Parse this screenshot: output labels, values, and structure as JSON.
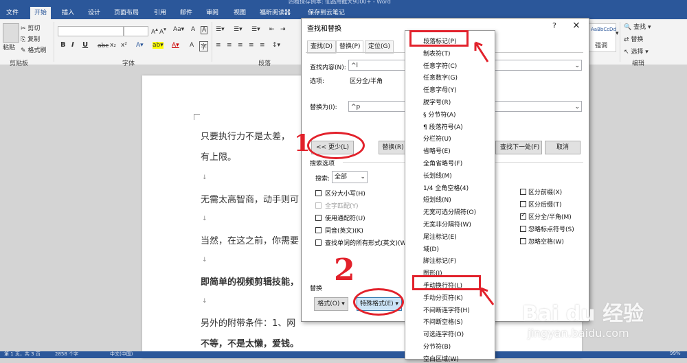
{
  "window": {
    "title": "四概保存例本: 仙品用截大9000+ - Word"
  },
  "tabs": [
    "文件",
    "开始",
    "插入",
    "设计",
    "页面布局",
    "引用",
    "邮件",
    "审阅",
    "视图",
    "福昕阅读器",
    "保存到云笔记"
  ],
  "active_tab": "开始",
  "ribbon": {
    "clipboard": {
      "paste": "粘贴",
      "cut": "剪切",
      "copy": "复制",
      "format_painter": "格式刷",
      "group": "剪贴板"
    },
    "font": {
      "group": "字体",
      "format_buttons": [
        "B",
        "I",
        "U",
        "abc",
        "x₂",
        "x²"
      ]
    },
    "paragraph": {
      "group": "段落"
    },
    "styles": {
      "sample": "AaBbCcDd",
      "label": "强调"
    },
    "editing": {
      "find": "查找",
      "replace": "替换",
      "select": "选择",
      "group": "编辑"
    }
  },
  "document": {
    "lines": [
      "只要执行力不是太差，",
      "有上限。",
      "无需太高智商，动手则可",
      "当然，在这之前，你需要",
      "即简单的视频剪辑技能，",
      "另外的附带条件：1、网",
      "不等，不是太懒，爱钱。"
    ]
  },
  "status": {
    "page": "第 1 页，共 3 页",
    "words": "2858 个字",
    "lang": "中文(中国)",
    "zoom": "99%"
  },
  "dialog": {
    "title": "查找和替换",
    "help": "?",
    "close": "×",
    "tabs": [
      "查找(D)",
      "替换(P)",
      "定位(G)"
    ],
    "active_tab": "替换(P)",
    "find_label": "查找内容(N):",
    "find_value": "^l",
    "options_label": "选项:",
    "options_value": "区分全/半角",
    "replace_label": "替换为(I):",
    "replace_value": "^p",
    "less_button": "<< 更少(L)",
    "replace_button": "替换(R)",
    "find_next_button": "查找下一处(F)",
    "cancel_button": "取消",
    "search_options_title": "搜索选项",
    "search_label": "搜索:",
    "search_value": "全部",
    "left_options": [
      {
        "label": "区分大小写(H)",
        "checked": false,
        "disabled": false
      },
      {
        "label": "全字匹配(Y)",
        "checked": false,
        "disabled": true
      },
      {
        "label": "使用通配符(U)",
        "checked": false,
        "disabled": false
      },
      {
        "label": "同音(英文)(K)",
        "checked": false,
        "disabled": false
      },
      {
        "label": "查找单词的所有形式(英文)(W)",
        "checked": false,
        "disabled": false
      }
    ],
    "right_options": [
      {
        "label": "区分前缀(X)",
        "checked": false
      },
      {
        "label": "区分后缀(T)",
        "checked": false
      },
      {
        "label": "区分全/半角(M)",
        "checked": true
      },
      {
        "label": "忽略标点符号(S)",
        "checked": false
      },
      {
        "label": "忽略空格(W)",
        "checked": false
      }
    ],
    "replace_section_label": "替换",
    "format_button": "格式(O) ▾",
    "special_button": "特殊格式(E) ▾",
    "no_format_button": ""
  },
  "special_menu": [
    "段落标记(P)",
    "制表符(T)",
    "任意字符(C)",
    "任意数字(G)",
    "任意字母(Y)",
    "脱字号(R)",
    "§ 分节符(A)",
    "¶ 段落符号(A)",
    "分栏符(U)",
    "省略号(E)",
    "全角省略号(F)",
    "长划线(M)",
    "1/4 全角空格(4)",
    "短划线(N)",
    "无宽可选分隔符(O)",
    "无宽非分隔符(W)",
    "尾注标记(E)",
    "域(D)",
    "脚注标记(F)",
    "图形(I)",
    "手动换行符(L)",
    "手动分页符(K)",
    "不间断连字符(H)",
    "不间断空格(S)",
    "可选连字符(O)",
    "分节符(B)",
    "空白区域(W)"
  ],
  "annotations": {
    "num1": "1",
    "num2": "2"
  },
  "watermark": {
    "brand": "Bai du 经验",
    "url": "jingyan.baidu.com"
  },
  "colors": {
    "accent": "#2b579a",
    "annotation_red": "#e2212b"
  }
}
